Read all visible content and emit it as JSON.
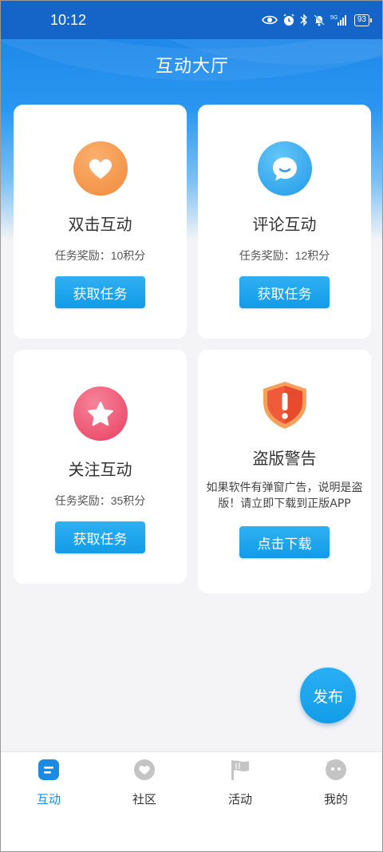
{
  "status_bar": {
    "time": "10:12",
    "battery": "93",
    "network": "5G"
  },
  "header": {
    "title": "互动大厅"
  },
  "cards": [
    {
      "title": "双击互动",
      "reward": "任务奖励：10积分",
      "button": "获取任务",
      "icon": "heart-icon",
      "color": "#f7914a"
    },
    {
      "title": "评论互动",
      "reward": "任务奖励：12积分",
      "button": "获取任务",
      "icon": "chat-bubble-icon",
      "color": "#2ea6f0"
    },
    {
      "title": "关注互动",
      "reward": "任务奖励：35积分",
      "button": "获取任务",
      "icon": "star-icon",
      "color": "#f0526f"
    }
  ],
  "warning": {
    "title": "盗版警告",
    "text": "如果软件有弹窗广告，说明是盗版！请立即下载到正版APP",
    "button": "点击下载",
    "icon": "shield-exclamation-icon"
  },
  "fab": {
    "label": "发布"
  },
  "tabbar": {
    "items": [
      {
        "label": "互动",
        "icon": "interaction-icon",
        "active": true
      },
      {
        "label": "社区",
        "icon": "community-icon",
        "active": false
      },
      {
        "label": "活动",
        "icon": "flag-icon",
        "active": false
      },
      {
        "label": "我的",
        "icon": "profile-icon",
        "active": false
      }
    ]
  },
  "colors": {
    "accent": "#1a8be0",
    "button": "#129be8",
    "header": "#1a82e6"
  }
}
